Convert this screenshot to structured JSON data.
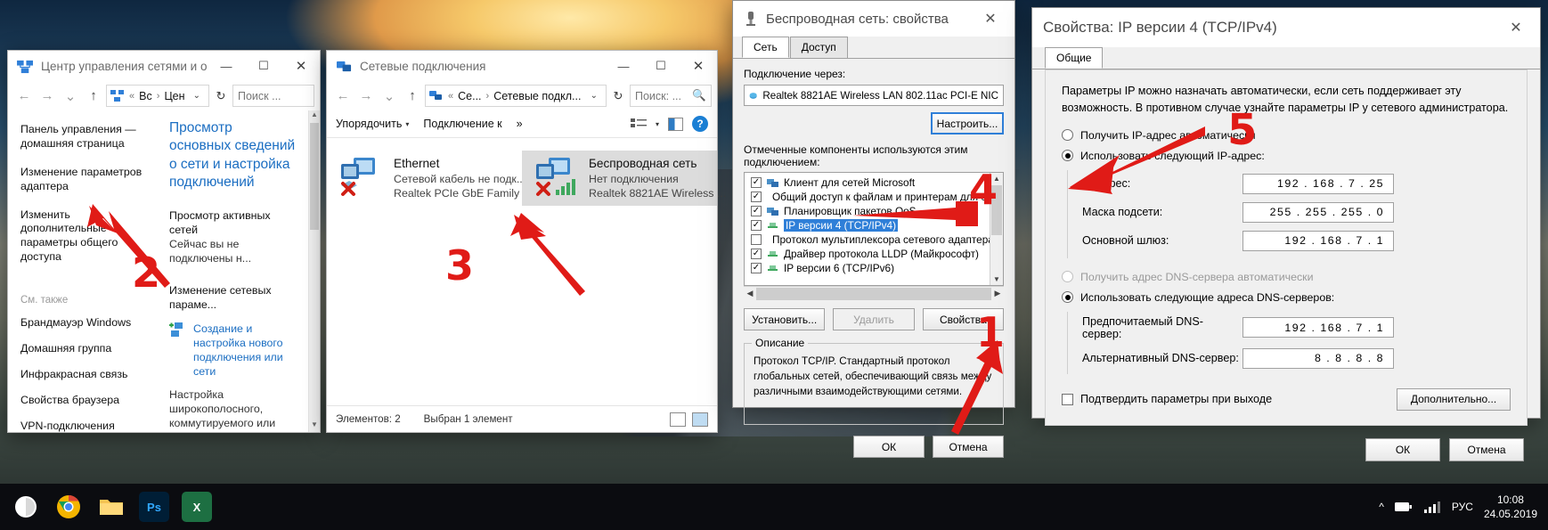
{
  "desktop": {
    "taskbar": {
      "icons": [
        "windows-start-icon",
        "chrome-icon",
        "file-explorer-icon",
        "photoshop-icon",
        "excel-icon"
      ],
      "tray": {
        "chevron": "^",
        "battery_icon": "battery-icon",
        "network_icon": "network-icon",
        "language": "РУС",
        "time": "10:08",
        "date": "24.05.2019"
      }
    }
  },
  "win1": {
    "title": "Центр управления сетями и об...",
    "icon": "network-sharing-icon",
    "buttons": {
      "minimize": "—",
      "maximize": "☐",
      "close": "✕"
    },
    "nav": {
      "back": "←",
      "forward": "→",
      "history": "⌄",
      "up": "↑"
    },
    "address": {
      "icon": "network-icon",
      "crumbs": [
        "Вс...",
        "Цент..."
      ],
      "separator": "›",
      "chevron": "⌄",
      "refresh": "↻"
    },
    "search": {
      "placeholder": "Поиск ...",
      "icon": "search-icon"
    },
    "left_links": [
      "Панель управления — домашняя страница",
      "Изменение параметров адаптера",
      "Изменить дополнительные параметры общего доступа"
    ],
    "see_also_header": "См. также",
    "see_also": [
      "Брандмауэр Windows",
      "Домашняя группа",
      "Инфракрасная связь",
      "Свойства браузера",
      "VPN-подключения"
    ],
    "right_title": "Просмотр основных сведений о сети и настройка подключений",
    "section1_header": "Просмотр активных сетей",
    "section1_text": "Сейчас вы не подключены н...",
    "section2_header": "Изменение сетевых параме...",
    "items": [
      {
        "icon": "new-connection-icon",
        "label": "Создание и настройка нового подключения или сети"
      },
      {
        "icon": "",
        "label": "Настройка широкополосного, коммутируемого или"
      }
    ]
  },
  "win2": {
    "title": "Сетевые подключения",
    "icon": "network-connections-icon",
    "buttons": {
      "minimize": "—",
      "maximize": "☐",
      "close": "✕"
    },
    "nav": {
      "back": "←",
      "forward": "→",
      "history": "⌄",
      "up": "↑"
    },
    "address": {
      "icon": "network-icon",
      "crumbs": [
        "Се...",
        "Сетевые подкл..."
      ],
      "separator": "›",
      "chevron": "⌄",
      "refresh": "↻"
    },
    "search": {
      "placeholder": "Поиск: ...",
      "icon": "search-icon"
    },
    "ribbon": {
      "organize": "Упорядочить",
      "connect_to": "Подключение к",
      "more": "»",
      "caret": "▾",
      "view_icon": "view-options-icon",
      "preview_icon": "preview-pane-icon",
      "help_icon": "help-icon"
    },
    "connections": [
      {
        "name": "Ethernet",
        "status": "Сетевой кабель не подк...",
        "adapter": "Realtek PCIe GbE Family ...",
        "selected": false,
        "overlay": "error-x-icon",
        "badge": "cable-icon"
      },
      {
        "name": "Беспроводная сеть",
        "status": "Нет подключения",
        "adapter": "Realtek 8821AE Wireless ...",
        "selected": true,
        "overlay": "error-x-icon",
        "badge": "signal-bars-icon"
      }
    ],
    "status": {
      "count": "Элементов: 2",
      "selection": "Выбран 1 элемент"
    }
  },
  "win3": {
    "title": "Беспроводная сеть: свойства",
    "icon": "wireless-properties-icon",
    "close": "✕",
    "tabs": [
      {
        "label": "Сеть",
        "active": true
      },
      {
        "label": "Доступ",
        "active": false
      }
    ],
    "connect_via_label": "Подключение через:",
    "adapter": {
      "icon": "adapter-icon",
      "name": "Realtek 8821AE Wireless LAN 802.11ac PCI-E NIC"
    },
    "configure_button": "Настроить...",
    "components_label": "Отмеченные компоненты используются этим подключением:",
    "components": [
      {
        "checked": true,
        "label": "Клиент для сетей Microsoft",
        "selected": false,
        "icon": "component-icon"
      },
      {
        "checked": true,
        "label": "Общий доступ к файлам и принтерам для сетей Micr",
        "selected": false,
        "icon": "component-icon"
      },
      {
        "checked": true,
        "label": "Планировщик пакетов QoS",
        "selected": false,
        "icon": "component-icon"
      },
      {
        "checked": true,
        "label": "IP версии 4 (TCP/IPv4)",
        "selected": true,
        "icon": "protocol-icon"
      },
      {
        "checked": false,
        "label": "Протокол мультиплексора сетевого адаптера (Майкр",
        "selected": false,
        "icon": "protocol-icon"
      },
      {
        "checked": true,
        "label": "Драйвер протокола LLDP (Майкрософт)",
        "selected": false,
        "icon": "protocol-icon"
      },
      {
        "checked": true,
        "label": "IP версии 6 (TCP/IPv6)",
        "selected": false,
        "icon": "protocol-icon"
      }
    ],
    "buttons": {
      "install": "Установить...",
      "uninstall": "Удалить",
      "properties": "Свойства"
    },
    "description_label": "Описание",
    "description_text": "Протокол TCP/IP. Стандартный протокол глобальных сетей, обеспечивающий связь между различными взаимодействующими сетями.",
    "ok": "ОК",
    "cancel": "Отмена"
  },
  "win4": {
    "title": "Свойства: IP версии 4 (TCP/IPv4)",
    "close": "✕",
    "tabs": [
      {
        "label": "Общие",
        "active": true
      }
    ],
    "intro": "Параметры IP можно назначать автоматически, если сеть поддерживает эту возможность. В противном случае узнайте параметры IP у сетевого администратора.",
    "ip_mode": {
      "auto": {
        "label": "Получить IP-адрес автоматически",
        "selected": false
      },
      "manual": {
        "label": "Использовать следующий IP-адрес:",
        "selected": true
      }
    },
    "fields": [
      {
        "label": "IP-адрес:",
        "value": "192 . 168 .  7  .  25"
      },
      {
        "label": "Маска подсети:",
        "value": "255 . 255 . 255 .  0"
      },
      {
        "label": "Основной шлюз:",
        "value": "192 . 168 .  7  .  1"
      }
    ],
    "dns_mode": {
      "auto": {
        "label": "Получить адрес DNS-сервера автоматически",
        "selected": false,
        "disabled": true
      },
      "manual": {
        "label": "Использовать следующие адреса DNS-серверов:",
        "selected": true
      }
    },
    "dns_fields": [
      {
        "label": "Предпочитаемый DNS-сервер:",
        "value": "192 . 168 .  7  .  1"
      },
      {
        "label": "Альтернативный DNS-сервер:",
        "value": "8  .  8  .  8  .  8"
      }
    ],
    "validate_checkbox": {
      "label": "Подтвердить параметры при выходе",
      "checked": false
    },
    "advanced_button": "Дополнительно...",
    "ok": "ОК",
    "cancel": "Отмена"
  },
  "annotations": {
    "color": "#e01b17",
    "steps": [
      {
        "number": "1",
        "target": "properties-button"
      },
      {
        "number": "2",
        "target": "change-adapter-settings-link"
      },
      {
        "number": "3",
        "target": "wireless-connection-item"
      },
      {
        "number": "4",
        "target": "ipv4-component-row"
      },
      {
        "number": "5",
        "target": "use-following-ip-radio"
      }
    ]
  }
}
